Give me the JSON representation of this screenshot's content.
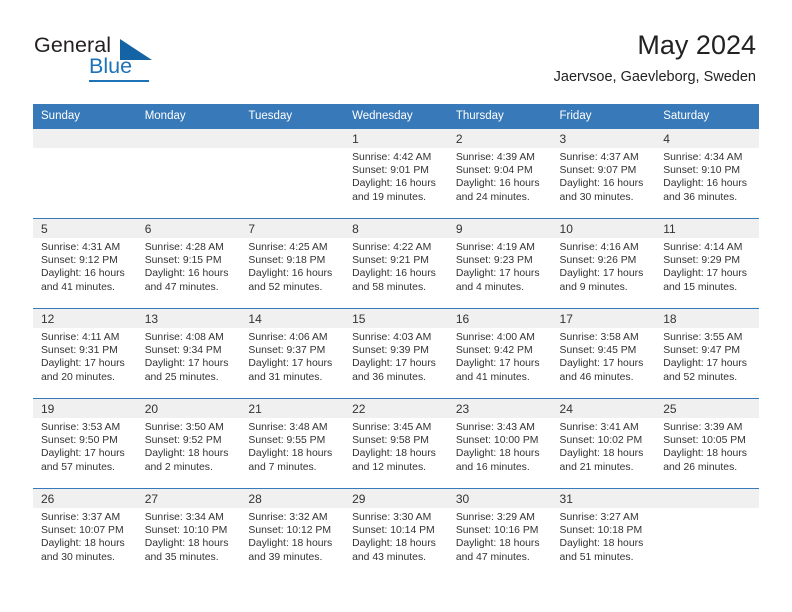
{
  "brand": {
    "name_part1": "General",
    "name_part2": "Blue",
    "accent_color": "#1d72b8"
  },
  "header": {
    "title": "May 2024",
    "subtitle": "Jaervsoe, Gaevleborg, Sweden"
  },
  "calendar": {
    "header_color": "#3879b9",
    "daynum_bg": "#f0f0f0",
    "weekday_headers": [
      "Sunday",
      "Monday",
      "Tuesday",
      "Wednesday",
      "Thursday",
      "Friday",
      "Saturday"
    ],
    "weeks": [
      [
        {
          "day": "",
          "empty": true
        },
        {
          "day": "",
          "empty": true
        },
        {
          "day": "",
          "empty": true
        },
        {
          "day": "1",
          "sunrise": "Sunrise: 4:42 AM",
          "sunset": "Sunset: 9:01 PM",
          "daylight1": "Daylight: 16 hours",
          "daylight2": "and 19 minutes."
        },
        {
          "day": "2",
          "sunrise": "Sunrise: 4:39 AM",
          "sunset": "Sunset: 9:04 PM",
          "daylight1": "Daylight: 16 hours",
          "daylight2": "and 24 minutes."
        },
        {
          "day": "3",
          "sunrise": "Sunrise: 4:37 AM",
          "sunset": "Sunset: 9:07 PM",
          "daylight1": "Daylight: 16 hours",
          "daylight2": "and 30 minutes."
        },
        {
          "day": "4",
          "sunrise": "Sunrise: 4:34 AM",
          "sunset": "Sunset: 9:10 PM",
          "daylight1": "Daylight: 16 hours",
          "daylight2": "and 36 minutes."
        }
      ],
      [
        {
          "day": "5",
          "sunrise": "Sunrise: 4:31 AM",
          "sunset": "Sunset: 9:12 PM",
          "daylight1": "Daylight: 16 hours",
          "daylight2": "and 41 minutes."
        },
        {
          "day": "6",
          "sunrise": "Sunrise: 4:28 AM",
          "sunset": "Sunset: 9:15 PM",
          "daylight1": "Daylight: 16 hours",
          "daylight2": "and 47 minutes."
        },
        {
          "day": "7",
          "sunrise": "Sunrise: 4:25 AM",
          "sunset": "Sunset: 9:18 PM",
          "daylight1": "Daylight: 16 hours",
          "daylight2": "and 52 minutes."
        },
        {
          "day": "8",
          "sunrise": "Sunrise: 4:22 AM",
          "sunset": "Sunset: 9:21 PM",
          "daylight1": "Daylight: 16 hours",
          "daylight2": "and 58 minutes."
        },
        {
          "day": "9",
          "sunrise": "Sunrise: 4:19 AM",
          "sunset": "Sunset: 9:23 PM",
          "daylight1": "Daylight: 17 hours",
          "daylight2": "and 4 minutes."
        },
        {
          "day": "10",
          "sunrise": "Sunrise: 4:16 AM",
          "sunset": "Sunset: 9:26 PM",
          "daylight1": "Daylight: 17 hours",
          "daylight2": "and 9 minutes."
        },
        {
          "day": "11",
          "sunrise": "Sunrise: 4:14 AM",
          "sunset": "Sunset: 9:29 PM",
          "daylight1": "Daylight: 17 hours",
          "daylight2": "and 15 minutes."
        }
      ],
      [
        {
          "day": "12",
          "sunrise": "Sunrise: 4:11 AM",
          "sunset": "Sunset: 9:31 PM",
          "daylight1": "Daylight: 17 hours",
          "daylight2": "and 20 minutes."
        },
        {
          "day": "13",
          "sunrise": "Sunrise: 4:08 AM",
          "sunset": "Sunset: 9:34 PM",
          "daylight1": "Daylight: 17 hours",
          "daylight2": "and 25 minutes."
        },
        {
          "day": "14",
          "sunrise": "Sunrise: 4:06 AM",
          "sunset": "Sunset: 9:37 PM",
          "daylight1": "Daylight: 17 hours",
          "daylight2": "and 31 minutes."
        },
        {
          "day": "15",
          "sunrise": "Sunrise: 4:03 AM",
          "sunset": "Sunset: 9:39 PM",
          "daylight1": "Daylight: 17 hours",
          "daylight2": "and 36 minutes."
        },
        {
          "day": "16",
          "sunrise": "Sunrise: 4:00 AM",
          "sunset": "Sunset: 9:42 PM",
          "daylight1": "Daylight: 17 hours",
          "daylight2": "and 41 minutes."
        },
        {
          "day": "17",
          "sunrise": "Sunrise: 3:58 AM",
          "sunset": "Sunset: 9:45 PM",
          "daylight1": "Daylight: 17 hours",
          "daylight2": "and 46 minutes."
        },
        {
          "day": "18",
          "sunrise": "Sunrise: 3:55 AM",
          "sunset": "Sunset: 9:47 PM",
          "daylight1": "Daylight: 17 hours",
          "daylight2": "and 52 minutes."
        }
      ],
      [
        {
          "day": "19",
          "sunrise": "Sunrise: 3:53 AM",
          "sunset": "Sunset: 9:50 PM",
          "daylight1": "Daylight: 17 hours",
          "daylight2": "and 57 minutes."
        },
        {
          "day": "20",
          "sunrise": "Sunrise: 3:50 AM",
          "sunset": "Sunset: 9:52 PM",
          "daylight1": "Daylight: 18 hours",
          "daylight2": "and 2 minutes."
        },
        {
          "day": "21",
          "sunrise": "Sunrise: 3:48 AM",
          "sunset": "Sunset: 9:55 PM",
          "daylight1": "Daylight: 18 hours",
          "daylight2": "and 7 minutes."
        },
        {
          "day": "22",
          "sunrise": "Sunrise: 3:45 AM",
          "sunset": "Sunset: 9:58 PM",
          "daylight1": "Daylight: 18 hours",
          "daylight2": "and 12 minutes."
        },
        {
          "day": "23",
          "sunrise": "Sunrise: 3:43 AM",
          "sunset": "Sunset: 10:00 PM",
          "daylight1": "Daylight: 18 hours",
          "daylight2": "and 16 minutes."
        },
        {
          "day": "24",
          "sunrise": "Sunrise: 3:41 AM",
          "sunset": "Sunset: 10:02 PM",
          "daylight1": "Daylight: 18 hours",
          "daylight2": "and 21 minutes."
        },
        {
          "day": "25",
          "sunrise": "Sunrise: 3:39 AM",
          "sunset": "Sunset: 10:05 PM",
          "daylight1": "Daylight: 18 hours",
          "daylight2": "and 26 minutes."
        }
      ],
      [
        {
          "day": "26",
          "sunrise": "Sunrise: 3:37 AM",
          "sunset": "Sunset: 10:07 PM",
          "daylight1": "Daylight: 18 hours",
          "daylight2": "and 30 minutes."
        },
        {
          "day": "27",
          "sunrise": "Sunrise: 3:34 AM",
          "sunset": "Sunset: 10:10 PM",
          "daylight1": "Daylight: 18 hours",
          "daylight2": "and 35 minutes."
        },
        {
          "day": "28",
          "sunrise": "Sunrise: 3:32 AM",
          "sunset": "Sunset: 10:12 PM",
          "daylight1": "Daylight: 18 hours",
          "daylight2": "and 39 minutes."
        },
        {
          "day": "29",
          "sunrise": "Sunrise: 3:30 AM",
          "sunset": "Sunset: 10:14 PM",
          "daylight1": "Daylight: 18 hours",
          "daylight2": "and 43 minutes."
        },
        {
          "day": "30",
          "sunrise": "Sunrise: 3:29 AM",
          "sunset": "Sunset: 10:16 PM",
          "daylight1": "Daylight: 18 hours",
          "daylight2": "and 47 minutes."
        },
        {
          "day": "31",
          "sunrise": "Sunrise: 3:27 AM",
          "sunset": "Sunset: 10:18 PM",
          "daylight1": "Daylight: 18 hours",
          "daylight2": "and 51 minutes."
        },
        {
          "day": "",
          "empty": true
        }
      ]
    ]
  }
}
